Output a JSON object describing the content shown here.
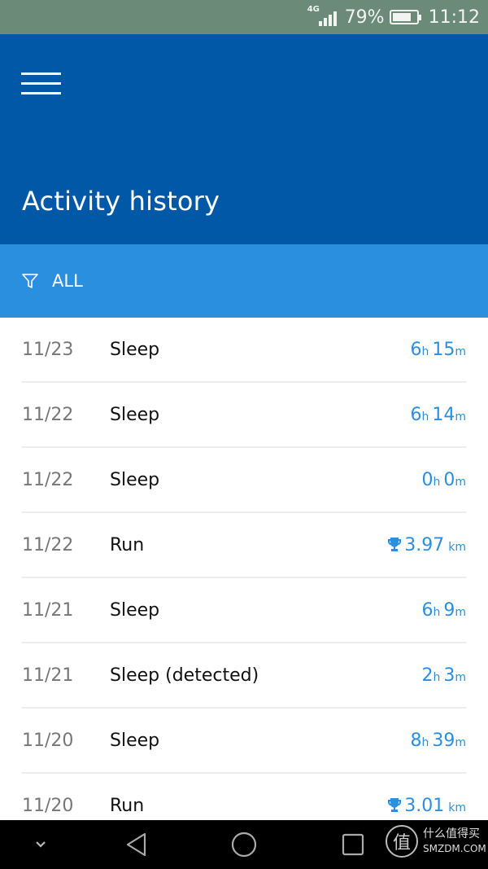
{
  "status_bar": {
    "network": "4G",
    "battery_percent": "79%",
    "battery_level": 0.79,
    "time": "11:12"
  },
  "header": {
    "menu_icon": "hamburger-menu-icon",
    "title": "Activity history"
  },
  "filter": {
    "icon": "filter-funnel-icon",
    "label": "ALL"
  },
  "activities": [
    {
      "date": "11/23",
      "type": "Sleep",
      "kind": "duration",
      "hours": "6",
      "minutes": "15",
      "h_unit": "h",
      "m_unit": "m"
    },
    {
      "date": "11/22",
      "type": "Sleep",
      "kind": "duration",
      "hours": "6",
      "minutes": "14",
      "h_unit": "h",
      "m_unit": "m"
    },
    {
      "date": "11/22",
      "type": "Sleep",
      "kind": "duration",
      "hours": "0",
      "minutes": "0",
      "h_unit": "h",
      "m_unit": "m"
    },
    {
      "date": "11/22",
      "type": "Run",
      "kind": "distance",
      "distance": "3.97",
      "unit": "km",
      "icon": "trophy-icon"
    },
    {
      "date": "11/21",
      "type": "Sleep",
      "kind": "duration",
      "hours": "6",
      "minutes": "9",
      "h_unit": "h",
      "m_unit": "m"
    },
    {
      "date": "11/21",
      "type": "Sleep (detected)",
      "kind": "duration",
      "hours": "2",
      "minutes": "3",
      "h_unit": "h",
      "m_unit": "m"
    },
    {
      "date": "11/20",
      "type": "Sleep",
      "kind": "duration",
      "hours": "8",
      "minutes": "39",
      "h_unit": "h",
      "m_unit": "m"
    },
    {
      "date": "11/20",
      "type": "Run",
      "kind": "distance",
      "distance": "3.01",
      "unit": "km",
      "icon": "trophy-icon"
    }
  ],
  "nav_bar": {
    "buttons": [
      "hide-nav-chevron",
      "back",
      "home",
      "recents"
    ]
  },
  "watermark": {
    "logo_char": "值",
    "title": "什么值得买",
    "subtitle": "SMZDM.COM"
  },
  "colors": {
    "header_bg": "#0058a6",
    "filter_bg": "#2b8fe0",
    "accent": "#2b8fe0",
    "status_bar_bg": "#6b8a78"
  }
}
